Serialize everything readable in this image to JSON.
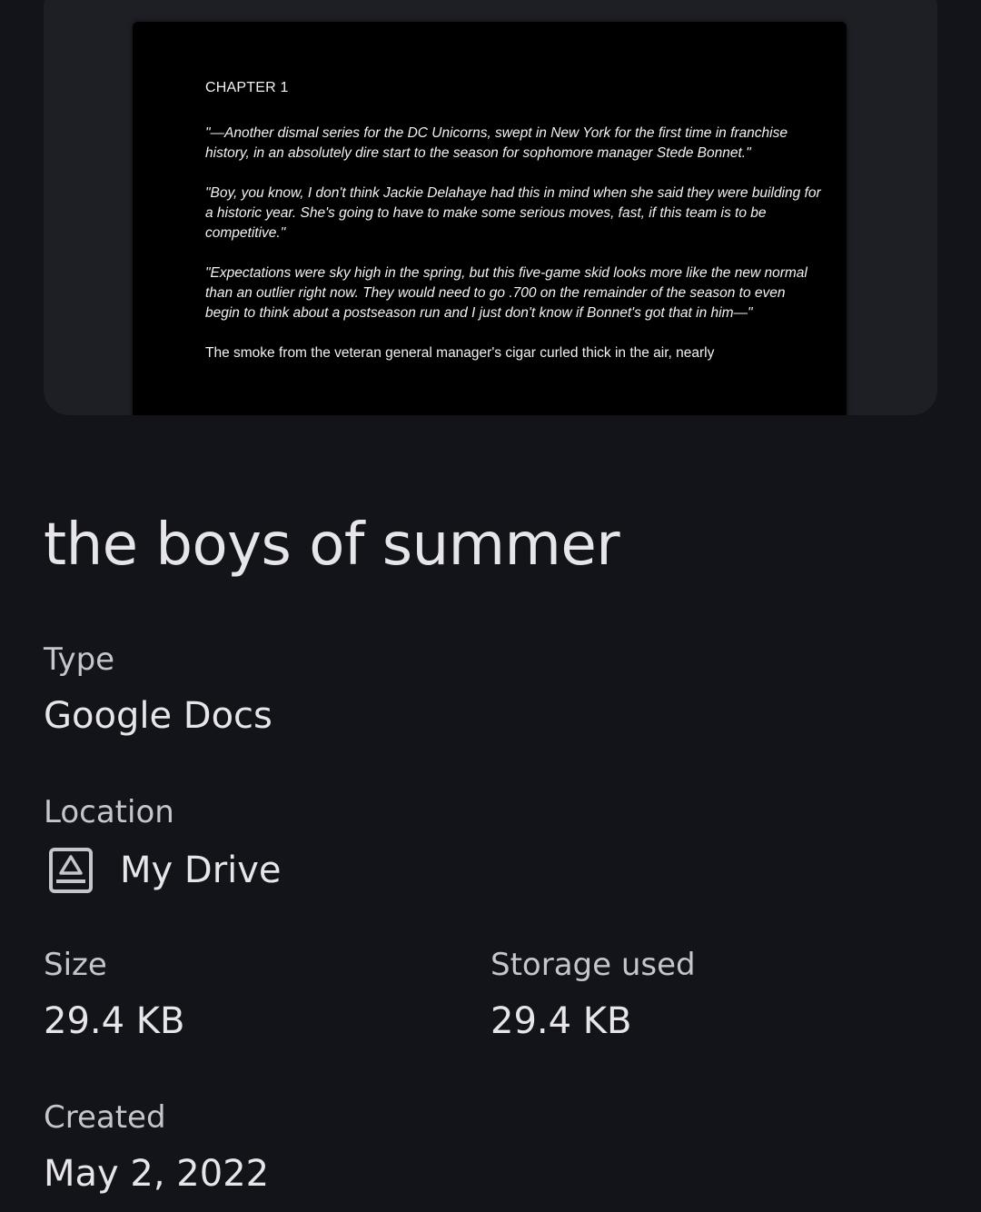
{
  "preview": {
    "heading": "CHAPTER 1",
    "paragraphs": [
      "\"—Another dismal series for the DC Unicorns, swept in New York for the first time in franchise history, in an absolutely dire start to the season for sophomore manager Stede Bonnet.\"",
      "\"Boy, you know, I don't think Jackie Delahaye had this in mind when she said they were building for a historic year. She's going to have to make some serious moves, fast, if this team is to be competitive.\"",
      "\"Expectations were sky high in the spring, but this five-game skid looks more like the new normal than an outlier right now. They would need to go .700 on the remainder of the season to even begin to think about a postseason run and I just don't know if Bonnet's got that in him—\"",
      "The smoke from the veteran general manager's cigar curled thick in the air, nearly"
    ]
  },
  "file": {
    "title": "the boys of summer"
  },
  "details": {
    "type_label": "Type",
    "type_value": "Google Docs",
    "location_label": "Location",
    "location_value": "My Drive",
    "location_icon": "drive-folder-icon",
    "size_label": "Size",
    "size_value": "29.4 KB",
    "storage_label": "Storage used",
    "storage_value": "29.4 KB",
    "created_label": "Created",
    "created_value": "May 2, 2022"
  }
}
